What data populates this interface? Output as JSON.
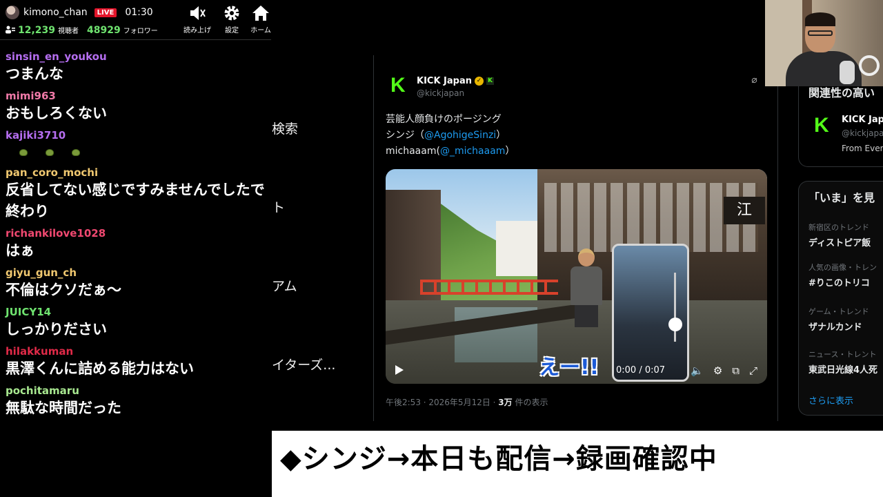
{
  "header": {
    "streamer": "kimono_chan",
    "live_label": "LIVE",
    "timer": "01:30",
    "viewers": "12,239",
    "viewers_label": "視聴者",
    "followers": "48929",
    "followers_label": "フォロワー",
    "actions": [
      {
        "label": "読み上げ",
        "icon": "speaker-icon"
      },
      {
        "label": "設定",
        "icon": "gear-icon"
      },
      {
        "label": "ホーム",
        "icon": "home-icon"
      }
    ]
  },
  "chat": [
    {
      "user": "sinsin_en_youkou",
      "color": "#b56ef0",
      "text": "つまんな"
    },
    {
      "user": "mimi963",
      "color": "#f07aa8",
      "text": "おもしろくない"
    },
    {
      "user": "kajiki3710",
      "color": "#b56ef0",
      "text": ""
    },
    {
      "user": "pan_coro_mochi",
      "color": "#f0c870",
      "text": "反省してない感じですみませんでしたで終わり"
    },
    {
      "user": "richankilove1028",
      "color": "#f04870",
      "text": "はぁ"
    },
    {
      "user": "giyu_gun_ch",
      "color": "#f0c870",
      "text": "不倫はクソだぁ～"
    },
    {
      "user": "JUICY14",
      "color": "#6fe36f",
      "text": "しっかりださい"
    },
    {
      "user": "hilakkuman",
      "color": "#e02a48",
      "text": "黒澤くんに詰める能力はない"
    },
    {
      "user": "pochitamaru",
      "color": "#a8e890",
      "text": "無駄な時間だった"
    }
  ],
  "sidebar": {
    "items": [
      "検索",
      "ト",
      "アム",
      "イターズ..."
    ]
  },
  "tweet": {
    "name": "KICK Japan",
    "handle": "@kickjapan",
    "line1": "芸能人顔負けのポージング",
    "line2_prefix": "シンジ（",
    "line2_link": "@AgohigeSinzi",
    "line2_suffix": "）",
    "line3_prefix": "michaaam(",
    "line3_link": "@_michaaam",
    "line3_suffix": "）",
    "video_caption": "えー!!",
    "video_sign": "江",
    "video_time": "0:00 / 0:07",
    "meta_prefix": "午後2:53 · 2026年5月12日 · ",
    "views": "3万",
    "views_suffix": " 件の表示"
  },
  "right_sidebar": {
    "related_title": "関連性の高い",
    "account_name": "KICK Japa",
    "account_handle": "@kickjapa",
    "account_desc": "From Ever",
    "trends_title": "「いま」を見",
    "trends": [
      {
        "category": "新宿区のトレンド",
        "name": "ディストピア飯"
      },
      {
        "category": "人気の画像・トレン",
        "name": "#りこのトリコ"
      },
      {
        "category": "ゲーム・トレンド",
        "name": "ザナルカンド"
      },
      {
        "category": "ニュース・トレント",
        "name": "東武日光線4人死"
      }
    ],
    "show_more": "さらに表示"
  },
  "ticker": {
    "text": "◆シンジ→本日も配信→録画確認中"
  },
  "colors": {
    "live": "#e3152b",
    "kick_green": "#53fc18",
    "link": "#1d9bf0"
  }
}
